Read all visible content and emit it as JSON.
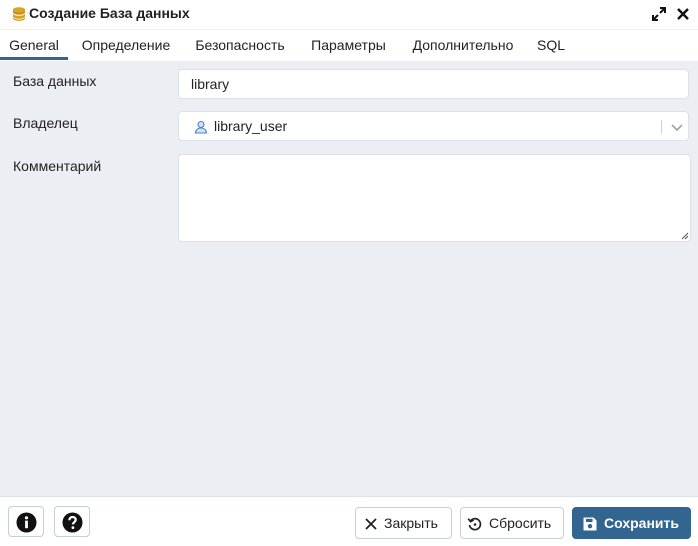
{
  "window": {
    "title": "Создание База данных",
    "icons": {
      "app": "database-icon",
      "expand": "expand-icon",
      "close": "close-icon"
    }
  },
  "tabs": [
    {
      "label": "General",
      "active": true
    },
    {
      "label": "Определение",
      "active": false
    },
    {
      "label": "Безопасность",
      "active": false
    },
    {
      "label": "Параметры",
      "active": false
    },
    {
      "label": "Дополнительно",
      "active": false
    },
    {
      "label": "SQL",
      "active": false
    }
  ],
  "form": {
    "database": {
      "label": "База данных",
      "value": "library"
    },
    "owner": {
      "label": "Владелец",
      "value": "library_user",
      "icon": "user-icon"
    },
    "comment": {
      "label": "Комментарий",
      "value": ""
    }
  },
  "footer": {
    "info_icon": "info-icon",
    "help_icon": "help-icon",
    "close_label": "Закрыть",
    "reset_label": "Сбросить",
    "save_label": "Сохранить"
  },
  "colors": {
    "accent": "#326690",
    "content_bg": "#ebeef3",
    "border": "#dde0e6"
  }
}
